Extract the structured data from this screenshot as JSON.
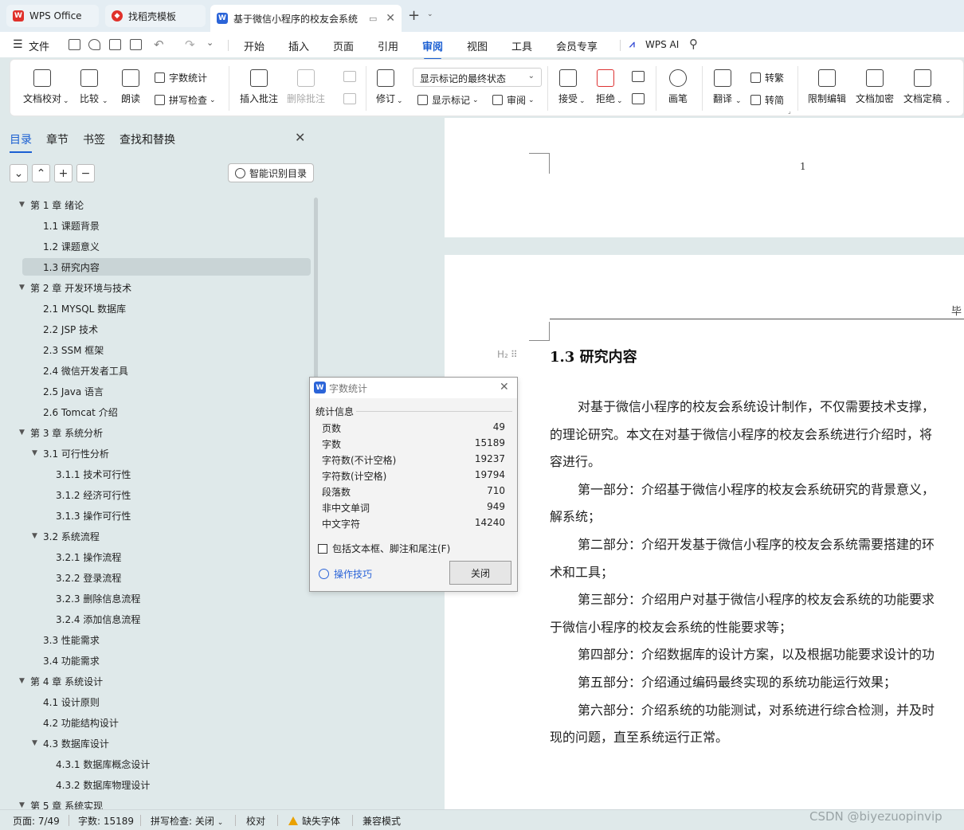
{
  "tabs": [
    {
      "label": "WPS Office",
      "icon": "wps-logo-icon"
    },
    {
      "label": "找稻壳模板",
      "icon": "docer-icon"
    },
    {
      "label": "基于微信小程序的校友会系统",
      "icon": "writer-doc-icon"
    }
  ],
  "menu": {
    "file": "文件",
    "items": [
      "开始",
      "插入",
      "页面",
      "引用",
      "审阅",
      "视图",
      "工具",
      "会员专享"
    ],
    "active": "审阅",
    "wps_ai": "WPS AI"
  },
  "ribbon": {
    "proofread": "文档校对",
    "compare": "比较",
    "read_aloud": "朗读",
    "word_count": "字数统计",
    "spell_check": "拼写检查",
    "insert_comment": "插入批注",
    "delete_comment": "删除批注",
    "revise": "修订",
    "markup_dropdown": "显示标记的最终状态",
    "show_markup": "显示标记",
    "review_pane": "审阅",
    "accept": "接受",
    "reject": "拒绝",
    "pen": "画笔",
    "translate": "翻译",
    "to_traditional": "转繁",
    "to_simplified": "转简",
    "restrict_edit": "限制编辑",
    "encrypt": "文档加密",
    "finalize": "文档定稿"
  },
  "nav": {
    "tabs": [
      "目录",
      "章节",
      "书签",
      "查找和替换"
    ],
    "active_tab": "目录",
    "smart_toc": "智能识别目录",
    "toc": [
      {
        "text": "第 1 章  绪论",
        "level": 1,
        "expanded": true
      },
      {
        "text": "1.1  课题背景",
        "level": 2
      },
      {
        "text": "1.2  课题意义",
        "level": 2
      },
      {
        "text": "1.3  研究内容",
        "level": 2,
        "selected": true
      },
      {
        "text": "第 2 章  开发环境与技术",
        "level": 1,
        "expanded": true
      },
      {
        "text": "2.1 MYSQL 数据库",
        "level": 2
      },
      {
        "text": "2.2 JSP 技术",
        "level": 2
      },
      {
        "text": "2.3 SSM 框架",
        "level": 2
      },
      {
        "text": "2.4  微信开发者工具",
        "level": 2
      },
      {
        "text": "2.5 Java 语言",
        "level": 2
      },
      {
        "text": "2.6 Tomcat  介绍",
        "level": 2
      },
      {
        "text": "第 3 章  系统分析",
        "level": 1,
        "expanded": true
      },
      {
        "text": "3.1  可行性分析",
        "level": 2,
        "expanded": true
      },
      {
        "text": "3.1.1  技术可行性",
        "level": 3
      },
      {
        "text": "3.1.2  经济可行性",
        "level": 3
      },
      {
        "text": "3.1.3  操作可行性",
        "level": 3
      },
      {
        "text": "3.2  系统流程",
        "level": 2,
        "expanded": true
      },
      {
        "text": "3.2.1  操作流程",
        "level": 3
      },
      {
        "text": "3.2.2  登录流程",
        "level": 3
      },
      {
        "text": "3.2.3  删除信息流程",
        "level": 3
      },
      {
        "text": "3.2.4  添加信息流程",
        "level": 3
      },
      {
        "text": "3.3  性能需求",
        "level": 2
      },
      {
        "text": "3.4  功能需求",
        "level": 2
      },
      {
        "text": "第 4 章  系统设计",
        "level": 1,
        "expanded": true
      },
      {
        "text": "4.1  设计原则",
        "level": 2
      },
      {
        "text": "4.2  功能结构设计",
        "level": 2
      },
      {
        "text": "4.3  数据库设计",
        "level": 2,
        "expanded": true
      },
      {
        "text": "4.3.1  数据库概念设计",
        "level": 3
      },
      {
        "text": "4.3.2  数据库物理设计",
        "level": 3
      },
      {
        "text": "第 5 章  系统实现",
        "level": 1,
        "expanded": true
      }
    ]
  },
  "document": {
    "page_number": "1",
    "header_text": "毕",
    "heading_tag": "H₂",
    "section_title": "1.3  研究内容",
    "lines": [
      "对基于微信小程序的校友会系统设计制作，不仅需要技术支撑，",
      "的理论研究。本文在对基于微信小程序的校友会系统进行介绍时，将",
      "容进行。",
      "第一部分：介绍基于微信小程序的校友会系统研究的背景意义，",
      "解系统；",
      "第二部分：介绍开发基于微信小程序的校友会系统需要搭建的环",
      "术和工具；",
      "第三部分：介绍用户对基于微信小程序的校友会系统的功能要求",
      "于微信小程序的校友会系统的性能要求等；",
      "第四部分：介绍数据库的设计方案，以及根据功能要求设计的功",
      "第五部分：介绍通过编码最终实现的系统功能运行效果；",
      "第六部分：介绍系统的功能测试，对系统进行综合检测，并及时",
      "现的问题，直至系统运行正常。"
    ]
  },
  "dialog": {
    "title": "字数统计",
    "section": "统计信息",
    "stats": [
      {
        "label": "页数",
        "value": "49"
      },
      {
        "label": "字数",
        "value": "15189"
      },
      {
        "label": "字符数(不计空格)",
        "value": "19237"
      },
      {
        "label": "字符数(计空格)",
        "value": "19794"
      },
      {
        "label": "段落数",
        "value": "710"
      },
      {
        "label": "非中文单词",
        "value": "949"
      },
      {
        "label": "中文字符",
        "value": "14240"
      }
    ],
    "checkbox": "包括文本框、脚注和尾注(F)",
    "tips": "操作技巧",
    "close": "关闭"
  },
  "status": {
    "page": "页面: 7/49",
    "words": "字数: 15189",
    "spell": "拼写检查: 关闭",
    "proof": "校对",
    "missing_font": "缺失字体",
    "compat": "兼容模式"
  },
  "watermark": "CSDN @biyezuopinvip",
  "colors": {
    "accent": "#1b5fd2",
    "wps_red": "#e0312b",
    "dialog_icon": "#2b64d8"
  }
}
